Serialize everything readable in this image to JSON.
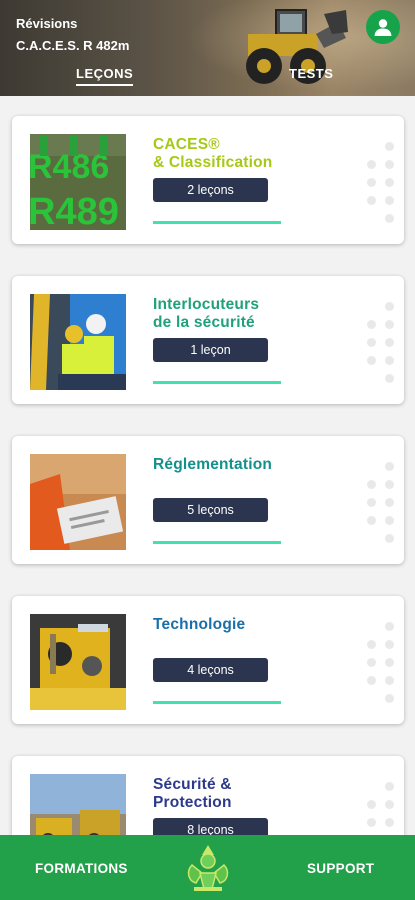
{
  "header": {
    "title": "Révisions",
    "subtitle": "C.A.C.E.S. R 482m",
    "profile_icon": "user-icon",
    "tabs": {
      "lessons": "LEÇONS",
      "tests": "TESTS"
    },
    "active_tab": "lessons"
  },
  "lessons": [
    {
      "title_line1": "CACES®",
      "title_line2": "& Classification",
      "count_label": "2 leçons",
      "title_color": "#a6c915",
      "thumb_text": [
        "R486",
        "R489"
      ]
    },
    {
      "title_line1": "Interlocuteurs",
      "title_line2": "de la sécurité",
      "count_label": "1 leçon",
      "title_color": "#1fa27a"
    },
    {
      "title_line1": "Réglementation",
      "title_line2": "",
      "count_label": "5 leçons",
      "title_color": "#12908a"
    },
    {
      "title_line1": "Technologie",
      "title_line2": "",
      "count_label": "4 leçons",
      "title_color": "#1a6fa8"
    },
    {
      "title_line1": "Sécurité &",
      "title_line2": "Protection",
      "count_label": "8 leçons",
      "title_color": "#2d3a8c"
    }
  ],
  "colors": {
    "accent_green": "#22a04a",
    "progress": "#3fe3b2",
    "badge": "#2c3550"
  },
  "bottom_nav": {
    "left": "FORMATIONS",
    "right": "SUPPORT",
    "logo_icon": "app-logo-icon"
  }
}
